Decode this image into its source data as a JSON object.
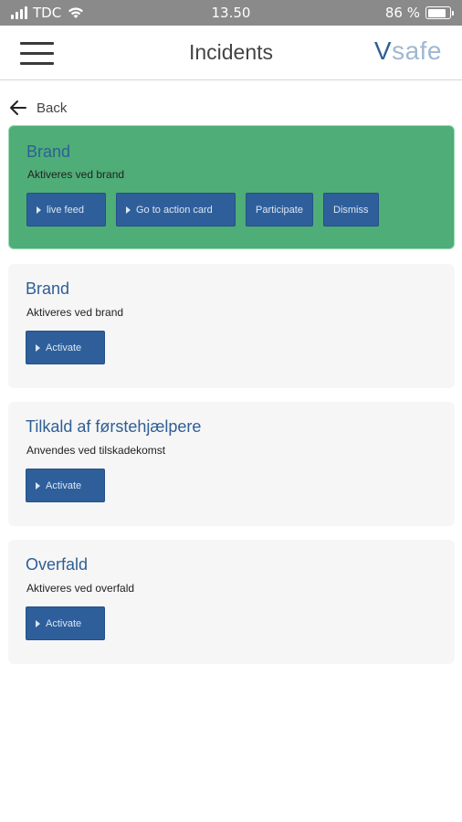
{
  "status_bar": {
    "carrier": "TDC",
    "time": "13.50",
    "battery": "86 %",
    "battery_level": 0.86
  },
  "header": {
    "title": "Incidents",
    "logo_v": "V",
    "logo_rest": "safe"
  },
  "nav": {
    "back_label": "Back"
  },
  "active_incident": {
    "title": "Brand",
    "description": "Aktiveres ved brand",
    "buttons": [
      "live feed",
      "Go to action card",
      "Participate",
      "Dismiss"
    ]
  },
  "incidents": [
    {
      "title": "Brand",
      "description": "Aktiveres ved brand",
      "button": "Activate"
    },
    {
      "title": "Tilkald af førstehjælpere",
      "description": "Anvendes ved tilskadekomst",
      "button": "Activate"
    },
    {
      "title": "Overfald",
      "description": "Aktiveres ved overfald",
      "button": "Activate"
    }
  ],
  "colors": {
    "active_card": "#4fad77",
    "button": "#2e5f9b",
    "title_blue": "#2e5f95",
    "status_bar": "#8a8a8a"
  }
}
